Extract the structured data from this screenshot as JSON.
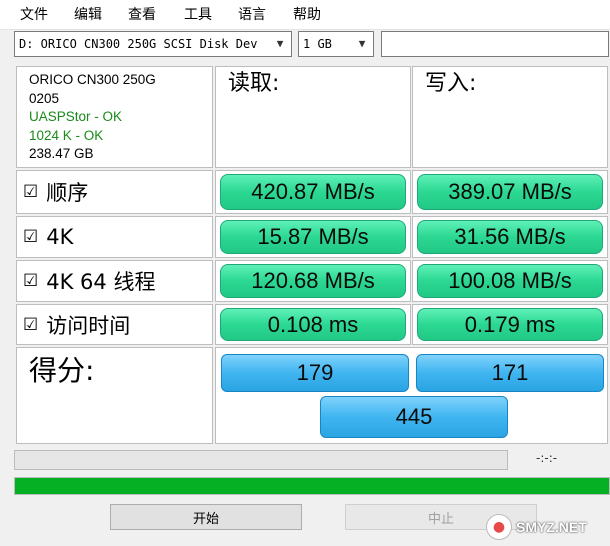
{
  "menu": [
    "文件",
    "编辑",
    "查看",
    "工具",
    "语言",
    "帮助"
  ],
  "toolbar": {
    "drive": "D: ORICO CN300 250G SCSI Disk Dev",
    "size": "1 GB",
    "text": ""
  },
  "info": {
    "model": "ORICO CN300 250G",
    "firmware": "0205",
    "driver": "UASPStor - OK",
    "align": "1024 K - OK",
    "capacity": "238.47 GB"
  },
  "headers": {
    "read": "读取:",
    "write": "写入:"
  },
  "rows": [
    {
      "label": "顺序",
      "read": "420.87 MB/s",
      "write": "389.07 MB/s"
    },
    {
      "label": "4K",
      "read": "15.87 MB/s",
      "write": "31.56 MB/s"
    },
    {
      "label": "4K 64 线程",
      "read": "120.68 MB/s",
      "write": "100.08 MB/s"
    },
    {
      "label": "访问时间",
      "read": "0.108 ms",
      "write": "0.179 ms"
    }
  ],
  "checkbox_glyph": "☑",
  "score": {
    "label": "得分:",
    "read": "179",
    "write": "171",
    "total": "445"
  },
  "progress": {
    "time": "-:-:-",
    "top_fraction": 0,
    "bottom_fraction": 1.0,
    "fill_color": "#06b025"
  },
  "buttons": {
    "start": "开始",
    "stop": "中止"
  },
  "watermark": {
    "text": "SMYZ.NET"
  }
}
